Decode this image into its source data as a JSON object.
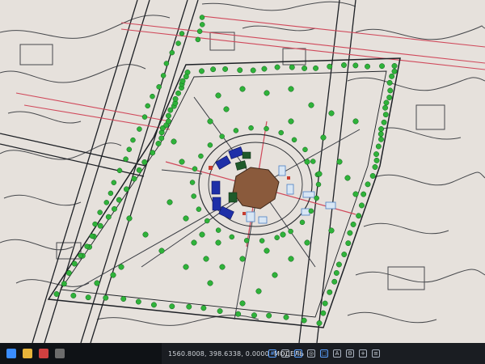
{
  "statusbar": {
    "coordinates": "1560.8008, 398.6338, 0.0000",
    "mode_label": "МОДЕЛЬ"
  },
  "colors": {
    "paper": "#e6e1dc",
    "linework": "#2b2e33",
    "road_red": "#d0485a",
    "tree_green": "#2fb23a",
    "plaza_brown": "#8a5a3c",
    "solar_blue": "#1e2fa8",
    "dark_green": "#1f5a2a"
  },
  "icons": [
    "windows-icon",
    "search-icon",
    "task-view-icon",
    "grid-icon",
    "snap-icon",
    "ortho-icon",
    "polar-icon",
    "osnap-icon",
    "annotation-icon",
    "workspace-icon",
    "plus-icon",
    "settings-icon"
  ]
}
